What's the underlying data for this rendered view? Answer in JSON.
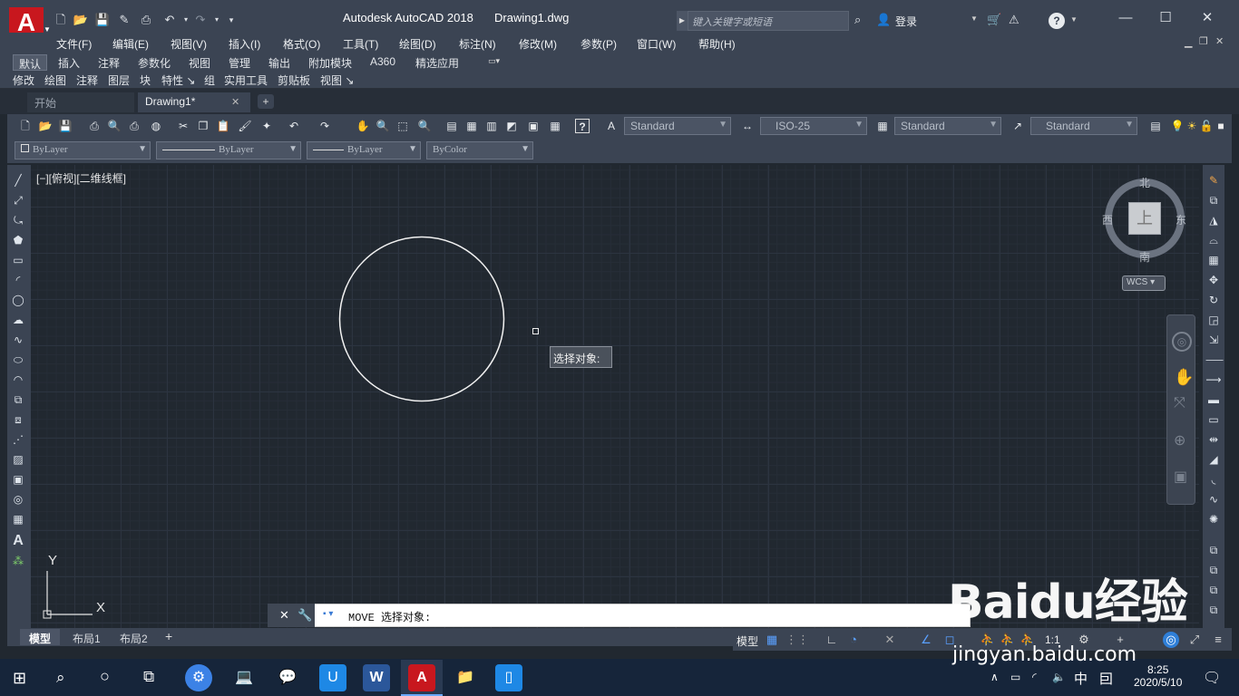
{
  "window": {
    "app_title": "Autodesk AutoCAD 2018",
    "document": "Drawing1.dwg",
    "logo": "A"
  },
  "search": {
    "placeholder": "键入关键字或短语"
  },
  "login": {
    "label": "登录"
  },
  "menu": [
    "文件(F)",
    "编辑(E)",
    "视图(V)",
    "插入(I)",
    "格式(O)",
    "工具(T)",
    "绘图(D)",
    "标注(N)",
    "修改(M)",
    "参数(P)",
    "窗口(W)",
    "帮助(H)"
  ],
  "ribbon_tabs": [
    "默认",
    "插入",
    "注释",
    "参数化",
    "视图",
    "管理",
    "输出",
    "附加模块",
    "A360",
    "精选应用"
  ],
  "panels": [
    "修改",
    "绘图",
    "注释",
    "图层",
    "块",
    "特性 ↘",
    "组",
    "实用工具",
    "剪贴板",
    "视图 ↘"
  ],
  "doc_tabs": {
    "start": "开始",
    "drawing": "Drawing1*"
  },
  "styles": {
    "text_style": "Standard",
    "dim_style": "ISO-25",
    "table_style": "Standard",
    "mleader_style": "Standard"
  },
  "properties": {
    "layer": "ByLayer",
    "linetype": "ByLayer",
    "lineweight": "ByLayer",
    "color": "ByColor"
  },
  "viewport": {
    "label": "[−][俯视][二维线框]"
  },
  "viewcube": {
    "face": "上",
    "north": "北",
    "south": "南",
    "east": "东",
    "west": "西",
    "wcs": "WCS"
  },
  "ucs": {
    "x": "X",
    "y": "Y"
  },
  "tooltip": {
    "text": "选择对象:"
  },
  "command": {
    "text": "MOVE 选择对象:"
  },
  "layout_tabs": [
    "模型",
    "布局1",
    "布局2"
  ],
  "status": {
    "model": "模型",
    "scale": "1:1"
  },
  "taskbar": {
    "ime": "中",
    "time": "8:25",
    "date": "2020/5/10"
  },
  "watermark": {
    "brand": "Baidu经验",
    "url": "jingyan.baidu.com"
  },
  "colors": {
    "accent": "#c8171e",
    "canvas": "#212830",
    "chrome": "#3b4453"
  }
}
